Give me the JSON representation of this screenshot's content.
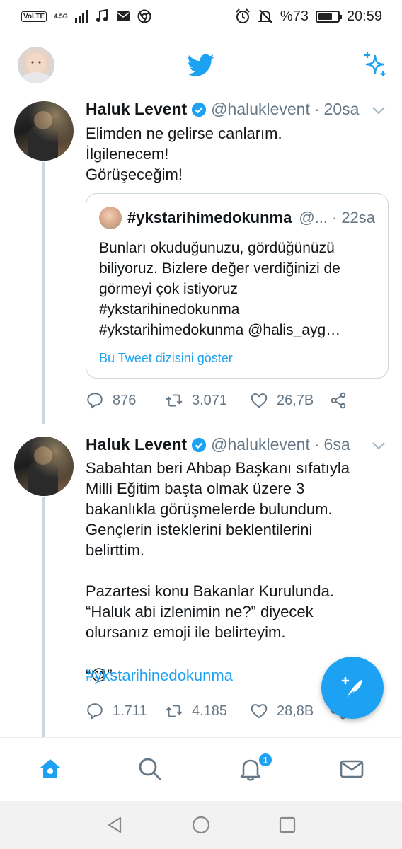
{
  "status_bar": {
    "volte": "VoLTE",
    "network": "4.5G",
    "battery_text": "%73",
    "battery_level": 0.73,
    "time": "20:59",
    "icons": [
      "signal-icon",
      "music-icon",
      "mail-icon",
      "chrome-icon",
      "alarm-icon",
      "mute-icon",
      "battery-icon"
    ]
  },
  "header": {
    "icons": [
      "profile-avatar",
      "twitter-bird-icon",
      "sparkle-icon"
    ]
  },
  "tweets": [
    {
      "name": "Haluk Levent",
      "handle": "@haluklevent",
      "dot": "·",
      "time": "20sa",
      "text": "Elimden ne gelirse canlarım.\nİlgilenecem!\nGörüşeceğim!",
      "quote": {
        "name": "#ykstarihimedokunma",
        "handle": "@...",
        "time": "22sa",
        "text": "Bunları okuduğunuzu, gördüğünüzü biliyoruz. Bizlere değer verdiğinizi de görmeyi çok istiyoruz\n#ykstarihinedokunma\n#ykstarihimedokunma  @halis_ayg…",
        "link": "Bu Tweet dizisini göster"
      },
      "replies": "876",
      "retweets": "3.071",
      "likes": "26,7B"
    },
    {
      "name": "Haluk Levent",
      "handle": "@haluklevent",
      "dot": "·",
      "time": "6sa",
      "text": "Sabahtan beri Ahbap Başkanı sıfatıyla Milli Eğitim başta olmak üzere 3 bakanlıkla görüşmelerde bulundum. Gençlerin isteklerini beklentilerini belirttim.\n\nPazartesi konu Bakanlar Kurulunda. “Haluk abi izlenimin ne?” diyecek olursanız emoji ile belirteyim.",
      "emoji_line_open": "“",
      "emoji": "😊",
      "emoji_line_close": "”",
      "hashtag": "#ykstarihinedokunma",
      "replies": "1.711",
      "retweets": "4.185",
      "likes": "28,8B"
    }
  ],
  "bottom_nav": {
    "items": [
      "home-icon",
      "search-icon",
      "notifications-icon",
      "messages-icon"
    ],
    "notification_badge": "1",
    "active": "home"
  },
  "colors": {
    "accent": "#1da1f2",
    "text": "#14171a",
    "secondary": "#657786",
    "border": "#e6ecf0"
  }
}
